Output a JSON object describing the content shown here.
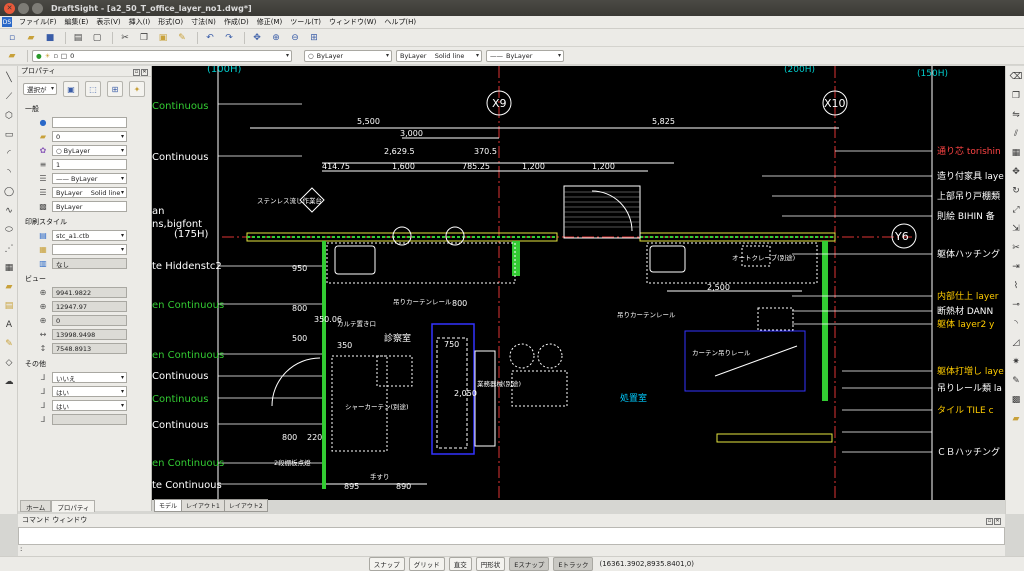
{
  "window": {
    "title": "DraftSight - [a2_50_T_office_layer_no1.dwg*]"
  },
  "menu": {
    "items": [
      "ファイル(F)",
      "編集(E)",
      "表示(V)",
      "挿入(I)",
      "形式(O)",
      "寸法(N)",
      "作成(D)",
      "修正(M)",
      "ツール(T)",
      "ウィンドウ(W)",
      "ヘルプ(H)"
    ]
  },
  "toolbar2": {
    "layer_value": "0",
    "color_value": "ByLayer",
    "linestyle_value": "ByLayer    Solid line",
    "lineweight_value": "ByLayer"
  },
  "properties": {
    "title": "プロパティ",
    "selector": "選択が",
    "sections": {
      "general": "一般",
      "print_style": "印刷スタイル",
      "view": "ビュー",
      "other": "その他"
    },
    "general": {
      "color_blank": "",
      "layer": "0",
      "color": "ByLayer",
      "scale": "1",
      "lineweight": "ByLayer",
      "linestyle": "ByLayer    Solid line",
      "linestyle2": "ByLayer"
    },
    "print_style": {
      "table": "stc_a1.ctb",
      "blank": "",
      "none": "なし"
    },
    "view": {
      "center_x": "9941.9822",
      "center_y": "12947.97",
      "center_z": "0",
      "width": "13998.9498",
      "height": "7548.8913"
    },
    "other": {
      "opt1": "いいえ",
      "opt2": "はい",
      "opt3": "はい",
      "opt4": ""
    }
  },
  "panel_tabs": [
    "ホーム",
    "プロパティ"
  ],
  "layout_tabs": [
    "モデル",
    "レイアウト1",
    "レイアウト2"
  ],
  "command": {
    "title": "コマンド ウィンドウ",
    "prompt": ":"
  },
  "status": {
    "buttons": [
      "スナップ",
      "グリッド",
      "直交",
      "円形状",
      "Eスナップ",
      "Eトラック"
    ],
    "coords": "(16361.3902,8935.8401,0)"
  },
  "drawing": {
    "labels_left": [
      "(100H)",
      "Continuous",
      "Continuous",
      "an",
      "ns,bigfont",
      "(175H)",
      "te Hiddenstc2",
      "en Continuous",
      "en Continuous",
      "Continuous",
      "Continuous",
      "Continuous",
      "en Continuous",
      "te Continuous"
    ],
    "labels_right": [
      "(200H)",
      "(150H)",
      "通り芯 torishin",
      "造り付家具 laye",
      "上部吊り戸棚類",
      "則絵 BIHIN 备",
      "躯体ハッチング",
      "内部仕上 layer",
      "断熱材  DANN",
      "躯体 layer2 y",
      "躯体打増し laye",
      "吊りレール類 la",
      "タイル  TILE c",
      "ＣＢハッチング"
    ],
    "grid_labels": [
      "X9",
      "X10",
      "Y6"
    ],
    "dims": [
      "5,500",
      "5,825",
      "3,000",
      "2,629.5",
      "370.5",
      "414.75",
      "1,600",
      "785.25",
      "1,200",
      "1,200",
      "2,500",
      "950",
      "800",
      "350",
      "500",
      "800",
      "350.06",
      "750",
      "2,050",
      "800",
      "220",
      "895",
      "890"
    ],
    "notes": [
      "ステンレス流し作業台",
      "カルテ置き口",
      "診察室",
      "処置室",
      "吊りカーテンレール",
      "吊りカーテンレール",
      "カーテン吊りレール",
      "シャーカーテン(別途)",
      "2段棚板点燈",
      "手すり",
      "オートクレーブ(別途)",
      "業務器械(別途)"
    ]
  }
}
